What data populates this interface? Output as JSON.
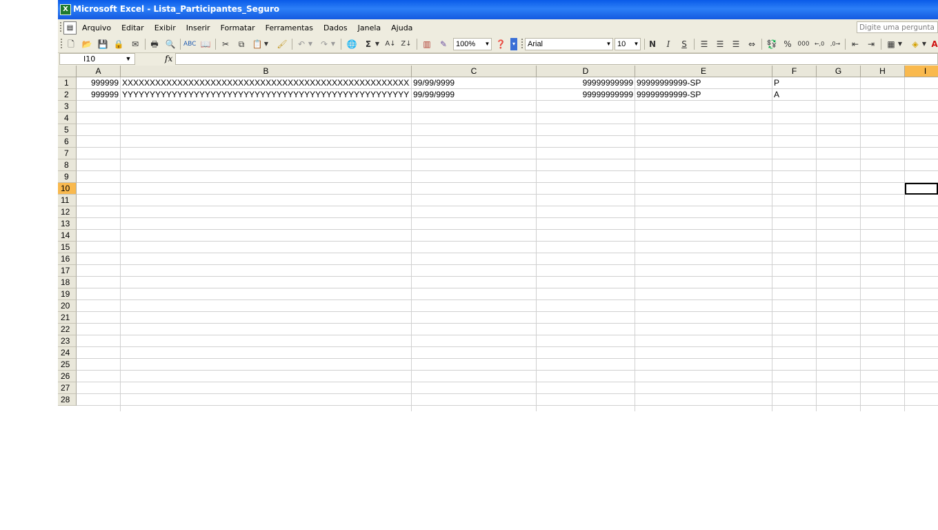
{
  "window": {
    "title": "Microsoft Excel - Lista_Participantes_Seguro"
  },
  "menu": {
    "items": [
      "Arquivo",
      "Editar",
      "Exibir",
      "Inserir",
      "Formatar",
      "Ferramentas",
      "Dados",
      "Janela",
      "Ajuda"
    ]
  },
  "help_box": {
    "placeholder": "Digite uma pergunta"
  },
  "toolbar": {
    "zoom": "100%",
    "font_name": "Arial",
    "font_size": "10",
    "bold_label": "N",
    "italic_label": "I",
    "underline_label": "S",
    "percent_label": "%",
    "thousands_label": "000",
    "sigma_label": "Σ"
  },
  "formula_bar": {
    "name_box": "I10",
    "fx_label": "fx",
    "formula": ""
  },
  "sheet": {
    "active_cell": "I10",
    "columns": [
      "A",
      "B",
      "C",
      "D",
      "E",
      "F",
      "G",
      "H",
      "I"
    ],
    "row_numbers": [
      "1",
      "2",
      "3",
      "4",
      "5",
      "6",
      "7",
      "8",
      "9",
      "10",
      "11",
      "12",
      "13",
      "14",
      "15",
      "16",
      "17",
      "18",
      "19",
      "20",
      "21",
      "22",
      "23",
      "24",
      "25",
      "26",
      "27",
      "28"
    ],
    "rows": [
      {
        "A": "999999",
        "B": "XXXXXXXXXXXXXXXXXXXXXXXXXXXXXXXXXXXXXXXXXXXXXXXXXXXXXXX",
        "C": "99/99/9999",
        "D": "99999999999",
        "E": "99999999999-SP",
        "F": "P"
      },
      {
        "A": "999999",
        "B": "YYYYYYYYYYYYYYYYYYYYYYYYYYYYYYYYYYYYYYYYYYYYYYYYYYYY",
        "C": "99/99/9999",
        "D": "99999999999",
        "E": "99999999999-SP",
        "F": "A"
      }
    ]
  }
}
